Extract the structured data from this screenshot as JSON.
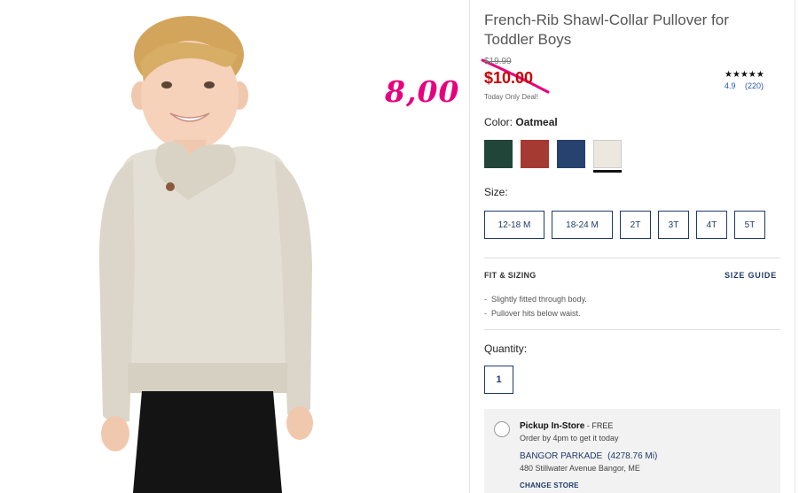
{
  "product": {
    "title": "French-Rib Shawl-Collar Pullover for Toddler Boys",
    "old_price": "$19.99",
    "sale_price": "$10.00",
    "today_only": "Today Only Deal!",
    "handwritten_price": "8,00"
  },
  "rating": {
    "stars": "★★★★★",
    "score": "4.9",
    "count": "(220)"
  },
  "color": {
    "label": "Color:",
    "selected": "Oatmeal",
    "swatches": [
      {
        "name": "swatch-green",
        "hex": "#22453a"
      },
      {
        "name": "swatch-red",
        "hex": "#a53a33"
      },
      {
        "name": "swatch-navy",
        "hex": "#27426e"
      },
      {
        "name": "swatch-oatmeal",
        "hex": "#ece8df"
      }
    ]
  },
  "size": {
    "label": "Size:",
    "options": [
      "12-18 M",
      "18-24 M",
      "2T",
      "3T",
      "4T",
      "5T"
    ]
  },
  "fit": {
    "heading": "FIT & SIZING",
    "size_guide": "SIZE GUIDE",
    "bullets": [
      "Slightly fitted through body.",
      "Pullover hits below waist."
    ]
  },
  "quantity": {
    "label": "Quantity:",
    "value": "1"
  },
  "pickup": {
    "title": "Pickup In-Store",
    "free": " - FREE",
    "subtitle": "Order by 4pm to get it today",
    "store_name": "BANGOR PARKADE",
    "distance": "(4278.76 Mi)",
    "address": "480 Stillwater Avenue Bangor, ME",
    "change_store": "CHANGE STORE"
  },
  "colors": {
    "accent_navy": "#1f3a6b",
    "sale_red": "#cc0000",
    "annotation_pink": "#e6007e"
  }
}
